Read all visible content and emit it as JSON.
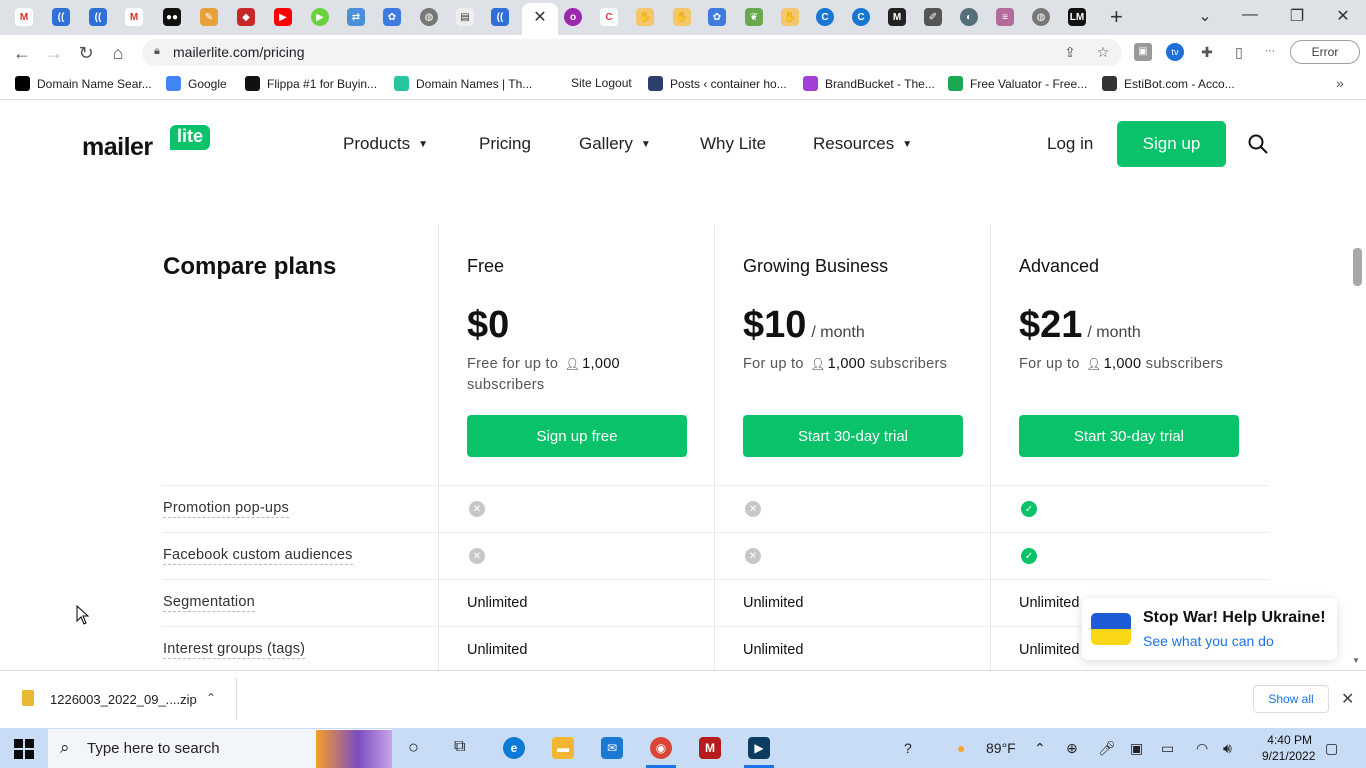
{
  "browser": {
    "url": "mailerlite.com/pricing",
    "error_label": "Error",
    "bookmarks": [
      {
        "label": "Domain Name Sear...",
        "icon": "dns-icon",
        "color": "#000"
      },
      {
        "label": "Google",
        "icon": "google-icon",
        "color": "#4285f4"
      },
      {
        "label": "Flippa #1 for Buyin...",
        "icon": "flippa-icon",
        "color": "#111"
      },
      {
        "label": "Domain Names | Th...",
        "icon": "domain-names-icon",
        "color": "#26c6a0"
      },
      {
        "label": "Site Logout",
        "icon": "",
        "color": ""
      },
      {
        "label": "Posts ‹ container ho...",
        "icon": "wordpress-icon",
        "color": "#2c3e6b"
      },
      {
        "label": "BrandBucket - The...",
        "icon": "brandbucket-icon",
        "color": "#a13fd6"
      },
      {
        "label": "Free Valuator - Free...",
        "icon": "valuator-icon",
        "color": "#1aa851"
      },
      {
        "label": "EstiBot.com - Acco...",
        "icon": "estibot-icon",
        "color": "#333"
      }
    ]
  },
  "site": {
    "logo_mailer": "mailer",
    "logo_lite": "lite",
    "nav": {
      "products": "Products",
      "pricing": "Pricing",
      "gallery": "Gallery",
      "why_lite": "Why Lite",
      "resources": "Resources"
    },
    "login": "Log in",
    "signup": "Sign up"
  },
  "compare": {
    "title": "Compare plans",
    "plans": [
      {
        "name": "Free",
        "price": "$0",
        "per": "",
        "sub_prefix": "Free for up to",
        "sub_count": "1,000",
        "sub_suffix": "subscribers",
        "button": "Sign up free"
      },
      {
        "name": "Growing Business",
        "price": "$10",
        "per": "/ month",
        "sub_prefix": "For up to",
        "sub_count": "1,000",
        "sub_suffix": "subscribers",
        "button": "Start 30-day trial"
      },
      {
        "name": "Advanced",
        "price": "$21",
        "per": "/ month",
        "sub_prefix": "For up to",
        "sub_count": "1,000",
        "sub_suffix": "subscribers",
        "button": "Start 30-day trial"
      }
    ],
    "features": [
      {
        "label": "Promotion pop-ups",
        "values": [
          "no",
          "no",
          "yes"
        ]
      },
      {
        "label": "Facebook custom audiences",
        "values": [
          "no",
          "no",
          "yes"
        ]
      },
      {
        "label": "Segmentation",
        "values": [
          "Unlimited",
          "Unlimited",
          "Unlimited"
        ]
      },
      {
        "label": "Interest groups (tags)",
        "values": [
          "Unlimited",
          "Unlimited",
          "Unlimited"
        ]
      }
    ]
  },
  "banner": {
    "title": "Stop War! Help Ukraine!",
    "link": "See what you can do"
  },
  "downloads": {
    "file": "1226003_2022_09_....zip",
    "show_all": "Show all"
  },
  "taskbar": {
    "search_placeholder": "Type here to search",
    "weather": "89°F",
    "time": "4:40 PM",
    "date": "9/21/2022"
  },
  "colors": {
    "brand_green": "#09c269",
    "link_blue": "#1a73e8"
  }
}
